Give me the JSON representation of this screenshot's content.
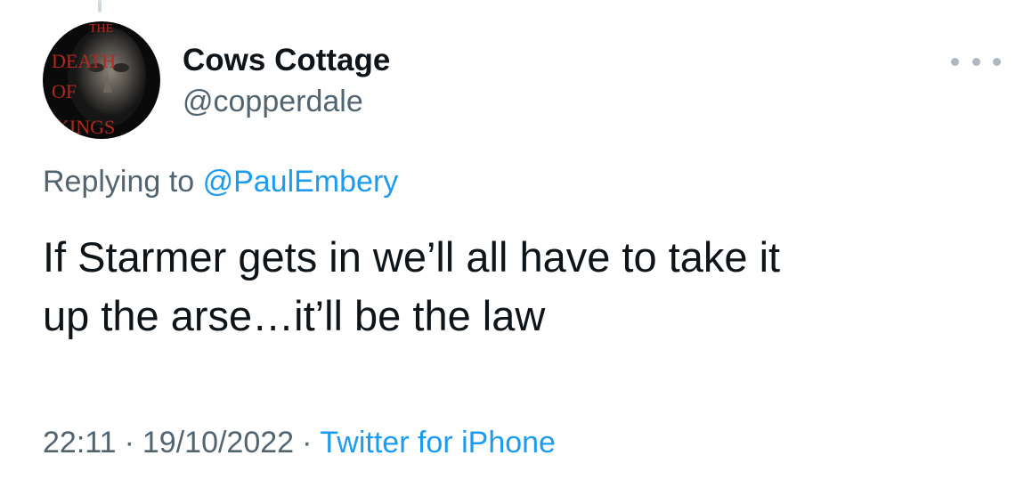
{
  "tweet": {
    "author": {
      "display_name": "Cows Cottage",
      "handle": "@copperdale",
      "avatar_text": [
        "THE",
        "DEATH",
        "OF",
        "KINGS"
      ]
    },
    "more_icon": "more-horizontal-icon",
    "replying_to_label": "Replying to",
    "replying_to_handle": "@PaulEmbery",
    "text_line_1": "If Starmer gets in we’ll all have to take it",
    "text_line_2": "up the arse…it’ll be the law",
    "time": "22:11",
    "separator": "·",
    "date": "19/10/2022",
    "source": "Twitter for iPhone"
  },
  "colors": {
    "text_primary": "#0f1419",
    "text_secondary": "#536471",
    "link": "#1d9bf0",
    "more_dots": "#aeb8c1"
  }
}
